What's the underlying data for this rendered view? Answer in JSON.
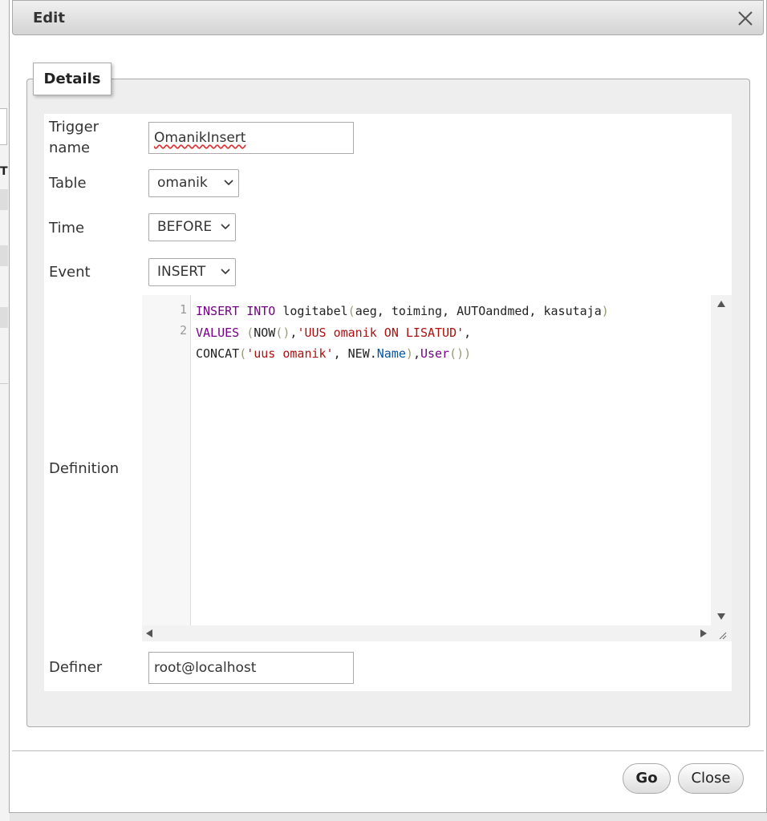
{
  "dialog": {
    "title": "Edit",
    "close_icon": "close-icon"
  },
  "fieldset": {
    "legend": "Details"
  },
  "form": {
    "trigger_name": {
      "label": "Trigger\nname",
      "value": "OmanikInsert"
    },
    "table": {
      "label": "Table",
      "value": "omanik"
    },
    "time": {
      "label": "Time",
      "value": "BEFORE"
    },
    "event": {
      "label": "Event",
      "value": "INSERT"
    },
    "definition": {
      "label": "Definition",
      "line_numbers": [
        "1",
        "2"
      ],
      "code_lines": [
        "INSERT INTO logitabel(aeg, toiming, AUTOandmed, kasutaja)",
        "VALUES (NOW(),'UUS omanik ON LISATUD',",
        "CONCAT('uus omanik', NEW.Name),User())"
      ]
    },
    "definer": {
      "label": "Definer",
      "value": "root@localhost"
    }
  },
  "footer": {
    "go_label": "Go",
    "close_label": "Close"
  },
  "colors": {
    "keyword": "#770088",
    "string": "#aa1111",
    "property": "#0055aa"
  }
}
